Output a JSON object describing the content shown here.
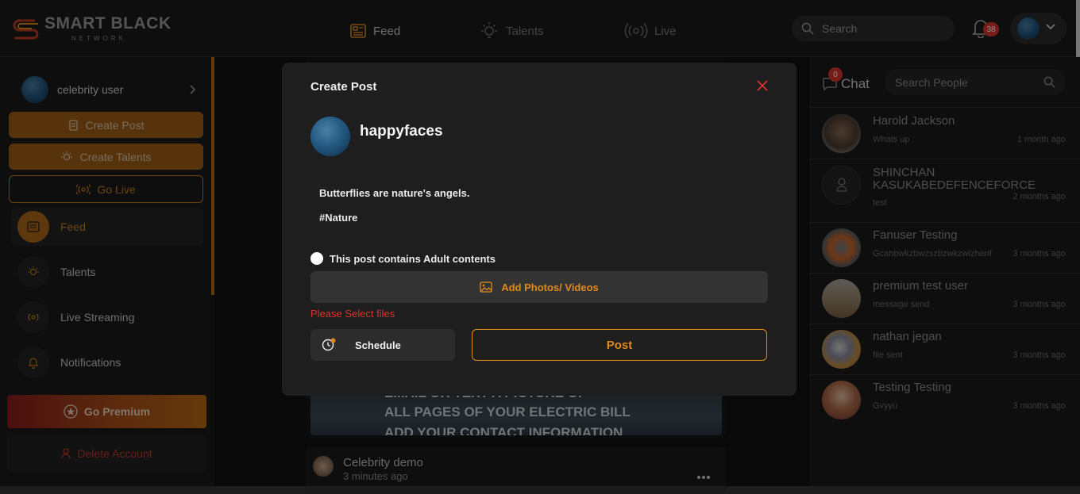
{
  "brand": {
    "name": "SMART BLACK",
    "sub": "NETWORK",
    "accent": "#c9822b"
  },
  "topnav": {
    "items": [
      {
        "label": "Feed",
        "icon": "feed-icon",
        "active": true
      },
      {
        "label": "Talents",
        "icon": "lightbulb-icon",
        "active": false
      },
      {
        "label": "Live",
        "icon": "broadcast-icon",
        "active": false
      }
    ],
    "search_placeholder": "Search",
    "notification_count": "38"
  },
  "sidebar": {
    "user_name": "celebrity user",
    "create_post": "Create Post",
    "create_talents": "Create Talents",
    "go_live": "Go Live",
    "menu": [
      {
        "label": "Feed",
        "icon": "feed-icon",
        "active": true
      },
      {
        "label": "Talents",
        "icon": "lightbulb-icon",
        "active": false
      },
      {
        "label": "Live Streaming",
        "icon": "broadcast-icon",
        "active": false
      },
      {
        "label": "Notifications",
        "icon": "bell-icon",
        "active": false
      }
    ],
    "go_premium": "Go Premium",
    "delete_account": "Delete Account"
  },
  "feed": {
    "image_lines": [
      "EMAIL OR TEXT A PICTURE OF",
      "ALL PAGES OF YOUR ELECTRIC BILL",
      "ADD YOUR CONTACT INFORMATION"
    ],
    "next_post": {
      "author": "Celebrity demo",
      "time": "3 minutes ago"
    }
  },
  "chat": {
    "title": "Chat",
    "badge": "0",
    "search_placeholder": "Search People",
    "conversations": [
      {
        "name": "Harold Jackson",
        "message": "Whats up",
        "time": "1 month ago"
      },
      {
        "name": "SHINCHAN KASUKABEDEFENCEFORCE",
        "message": "test",
        "time": "2 months ago"
      },
      {
        "name": "Fanuser Testing",
        "message": "Gcahbwkzbwzszbzwkzwizherif",
        "time": "3 months ago"
      },
      {
        "name": "premium test user",
        "message": "message send",
        "time": "3 months ago"
      },
      {
        "name": "nathan jegan",
        "message": "file sent",
        "time": "3 months ago"
      },
      {
        "name": "Testing Testing",
        "message": "Gvyyu",
        "time": "3 months ago"
      }
    ]
  },
  "modal": {
    "title": "Create Post",
    "username": "happyfaces",
    "text_line1": "Butterflies are nature's angels.",
    "text_line2": "#Nature",
    "adult_label": "This post contains Adult contents",
    "add_media": "Add Photos/ Videos",
    "error": "Please Select files",
    "schedule": "Schedule",
    "post": "Post"
  }
}
